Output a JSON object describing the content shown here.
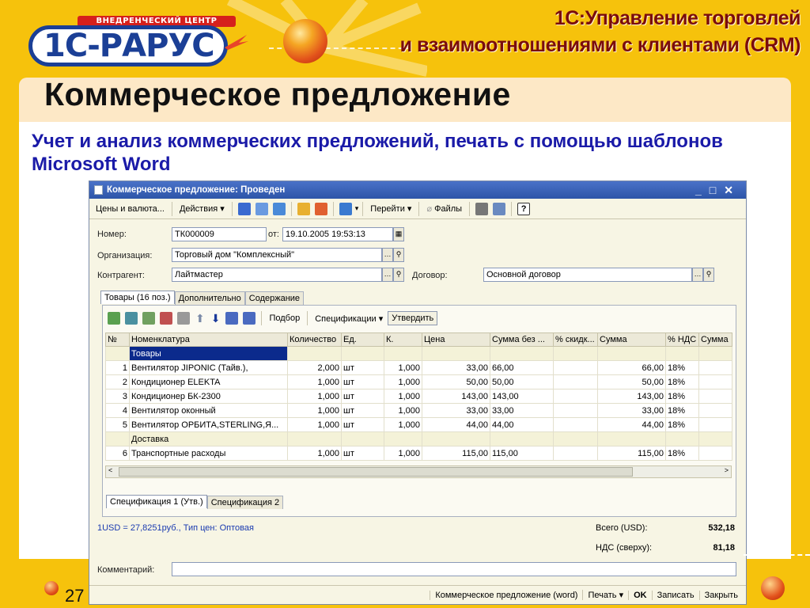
{
  "header": {
    "logo_tagline": "ВНЕДРЕНЧЕСКИЙ ЦЕНТР",
    "logo_text": "1С-РАРУС",
    "product_line1": "1С:Управление торговлей",
    "product_line2": "и взаимоотношениями с клиентами (CRM)"
  },
  "slide": {
    "title": "Коммерческое предложение",
    "subtitle": "Учет и анализ коммерческих предложений, печать с помощью шаблонов Microsoft Word",
    "page_number": "27"
  },
  "window": {
    "title": "Коммерческое предложение: Проведен",
    "toolbar": {
      "prices": "Цены и валюта...",
      "actions": "Действия",
      "go": "Перейти",
      "files": "Файлы"
    },
    "fields": {
      "number_label": "Номер:",
      "number": "ТК000009",
      "date_label": "от:",
      "date": "19.10.2005 19:53:13",
      "org_label": "Организация:",
      "org": "Торговый дом \"Комплексный\"",
      "counterparty_label": "Контрагент:",
      "counterparty": "Лайтмастер",
      "contract_label": "Договор:",
      "contract": "Основной договор"
    },
    "tabs": [
      "Товары (16 поз.)",
      "Дополнительно",
      "Содержание"
    ],
    "grid_toolbar": {
      "select": "Подбор",
      "specs": "Спецификации",
      "approve": "Утвердить"
    },
    "columns": [
      "№",
      "Номенклатура",
      "Количество",
      "Ед.",
      "К.",
      "Цена",
      "Сумма без ...",
      "% скидк...",
      "Сумма",
      "% НДС",
      "Сумма"
    ],
    "rows": [
      {
        "type": "group",
        "name": "Товары"
      },
      {
        "type": "item",
        "n": "1",
        "name": "Вентилятор JIPONIC (Тайв.),",
        "qty": "2,000",
        "unit": "шт",
        "k": "1,000",
        "price": "33,00",
        "sum_wo": "66,00",
        "disc": "",
        "sum": "66,00",
        "vat": "18%",
        "vat_sum": ""
      },
      {
        "type": "item",
        "n": "2",
        "name": "Кондиционер ELEKTA",
        "qty": "1,000",
        "unit": "шт",
        "k": "1,000",
        "price": "50,00",
        "sum_wo": "50,00",
        "disc": "",
        "sum": "50,00",
        "vat": "18%",
        "vat_sum": ""
      },
      {
        "type": "item",
        "n": "3",
        "name": "Кондиционер БК-2300",
        "qty": "1,000",
        "unit": "шт",
        "k": "1,000",
        "price": "143,00",
        "sum_wo": "143,00",
        "disc": "",
        "sum": "143,00",
        "vat": "18%",
        "vat_sum": ""
      },
      {
        "type": "item",
        "n": "4",
        "name": "Вентилятор оконный",
        "qty": "1,000",
        "unit": "шт",
        "k": "1,000",
        "price": "33,00",
        "sum_wo": "33,00",
        "disc": "",
        "sum": "33,00",
        "vat": "18%",
        "vat_sum": ""
      },
      {
        "type": "item",
        "n": "5",
        "name": "Вентилятор ОРБИТА,STERLING,Я...",
        "qty": "1,000",
        "unit": "шт",
        "k": "1,000",
        "price": "44,00",
        "sum_wo": "44,00",
        "disc": "",
        "sum": "44,00",
        "vat": "18%",
        "vat_sum": ""
      },
      {
        "type": "group",
        "name": "Доставка"
      },
      {
        "type": "item",
        "n": "6",
        "name": "Транспортные расходы",
        "qty": "1,000",
        "unit": "шт",
        "k": "1,000",
        "price": "115,00",
        "sum_wo": "115,00",
        "disc": "",
        "sum": "115,00",
        "vat": "18%",
        "vat_sum": ""
      }
    ],
    "bottom_tabs": [
      "Спецификация 1 (Утв.)",
      "Спецификация 2"
    ],
    "rate_text": "1USD = 27,8251руб., Тип цен: Оптовая",
    "total_label": "Всего (USD):",
    "total": "532,18",
    "vat_label": "НДС (сверху):",
    "vat_total": "81,18",
    "comment_label": "Комментарий:",
    "comment": "",
    "status": {
      "print_word": "Коммерческое предложение (word)",
      "print": "Печать",
      "ok": "OK",
      "save": "Записать",
      "close": "Закрыть"
    }
  }
}
